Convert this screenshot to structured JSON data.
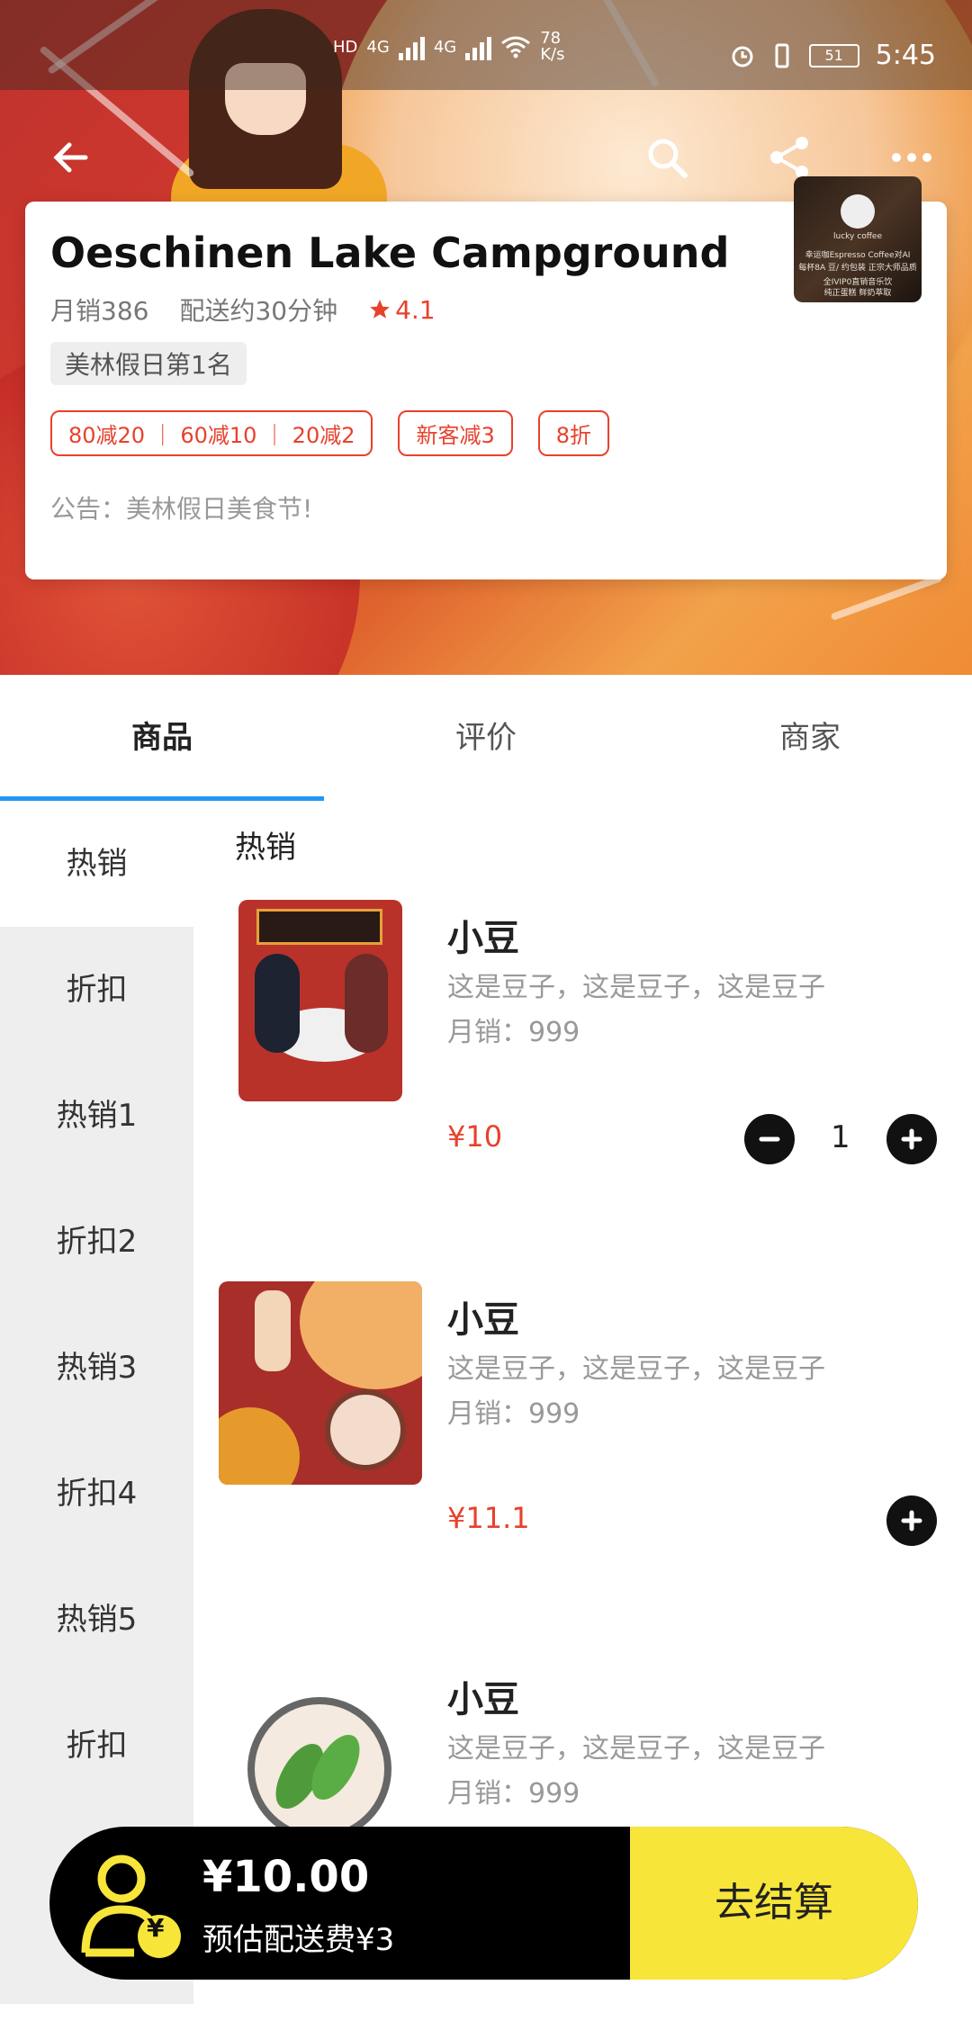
{
  "status_bar": {
    "net_left_1": "HD",
    "net_left_2": "4G",
    "net_left_3": "4G",
    "speed_value": "78",
    "speed_unit": "K/s",
    "battery": "51",
    "time": "5:45"
  },
  "nav": {
    "back_icon": "arrow-left-icon",
    "search_icon": "search-icon",
    "share_icon": "share-icon",
    "more_icon": "more-icon"
  },
  "shop": {
    "name": "Oeschinen Lake Campground",
    "monthly_sales": "月销386",
    "delivery": "配送约30分钟",
    "rating": "4.1",
    "rank": "美林假日第1名",
    "promos": [
      "80减20 ｜ 60减10 ｜ 20减2",
      "新客减3",
      "8折"
    ],
    "notice": "公告：美林假日美食节!",
    "logo_text_1": "lucky coffee",
    "logo_text_2": "幸运咖Espresso Coffee对AI",
    "logo_text_3": "每杯8A 豆/ 约包装 正宗大师品质",
    "logo_text_4": "全IVIP0直销音乐饮",
    "logo_text_5": "纯正蛋糕 鲜奶萃取"
  },
  "tabs": [
    "商品",
    "评价",
    "商家"
  ],
  "side_menu": [
    "热销",
    "折扣",
    "热销1",
    "折扣2",
    "热销3",
    "折扣4",
    "热销5",
    "折扣",
    "折扣"
  ],
  "section_title": "热销",
  "products": [
    {
      "name": "小豆",
      "desc": "这是豆子，这是豆子，这是豆子",
      "sales": "月销：999",
      "price": "¥10",
      "qty": "1"
    },
    {
      "name": "小豆",
      "desc": "这是豆子，这是豆子，这是豆子",
      "sales": "月销：999",
      "price": "¥11.1"
    },
    {
      "name": "小豆",
      "desc": "这是豆子，这是豆子，这是豆子",
      "sales": "月销：999"
    }
  ],
  "cart": {
    "total": "¥10.00",
    "delivery_fee": "预估配送费¥3",
    "checkout_label": "去结算",
    "badge": "¥"
  },
  "colors": {
    "accent_red": "#e8412c",
    "tab_indicator": "#2196f3",
    "checkout_yellow": "#f7e53a"
  }
}
